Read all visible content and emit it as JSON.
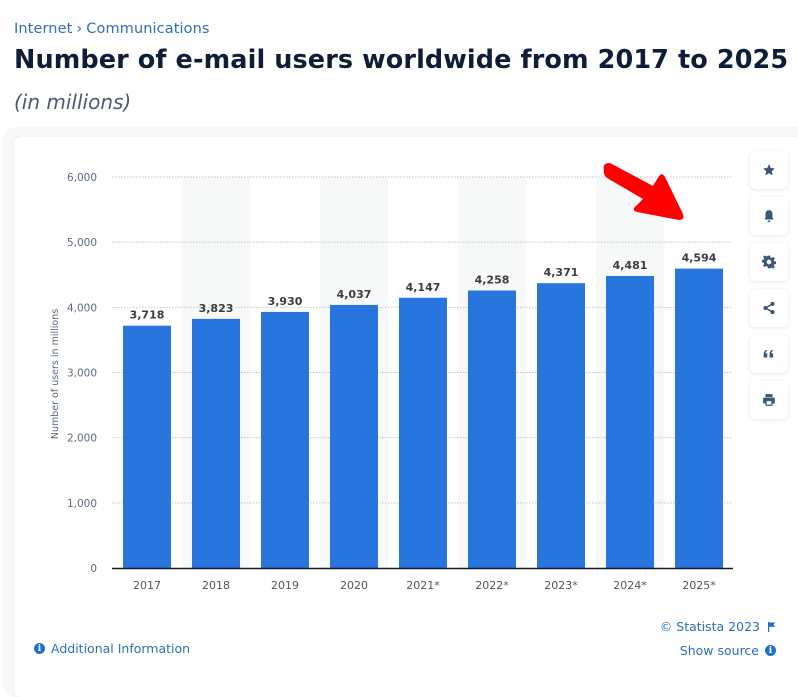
{
  "breadcrumb": {
    "items": [
      "Internet",
      "Communications"
    ],
    "separator": "›"
  },
  "header": {
    "title": "Number of e-mail users worldwide from 2017 to 2025",
    "subtitle": "(in millions)"
  },
  "toolbar": {
    "buttons": [
      {
        "name": "favorite",
        "icon": "star-icon"
      },
      {
        "name": "notification",
        "icon": "bell-icon"
      },
      {
        "name": "settings",
        "icon": "gear-icon"
      },
      {
        "name": "share",
        "icon": "share-icon"
      },
      {
        "name": "cite",
        "icon": "quote-icon"
      },
      {
        "name": "print",
        "icon": "print-icon"
      }
    ]
  },
  "footer": {
    "additional_info": "Additional Information",
    "copyright": "© Statista 2023",
    "show_source": "Show source"
  },
  "annotation": {
    "type": "arrow",
    "color": "#ff0000",
    "points_to": "2025*"
  },
  "colors": {
    "bar": "#2876dd",
    "link": "#2d6fbb",
    "title": "#0f1e36",
    "icon": "#3d5578"
  },
  "chart_data": {
    "type": "bar",
    "title": "Number of e-mail users worldwide from 2017 to 2025",
    "subtitle": "(in millions)",
    "xlabel": "",
    "ylabel": "Number of users in millions",
    "categories": [
      "2017",
      "2018",
      "2019",
      "2020",
      "2021*",
      "2022*",
      "2023*",
      "2024*",
      "2025*"
    ],
    "values": [
      3718,
      3823,
      3930,
      4037,
      4147,
      4258,
      4371,
      4481,
      4594
    ],
    "value_labels": [
      "3,718",
      "3,823",
      "3,930",
      "4,037",
      "4,147",
      "4,258",
      "4,371",
      "4,481",
      "4,594"
    ],
    "ylim": [
      0,
      6000
    ],
    "yticks": [
      0,
      1000,
      2000,
      3000,
      4000,
      5000,
      6000
    ],
    "ytick_labels": [
      "0",
      "1,000",
      "2,000",
      "3,000",
      "4,000",
      "5,000",
      "6,000"
    ],
    "grid": true,
    "legend": "none"
  }
}
